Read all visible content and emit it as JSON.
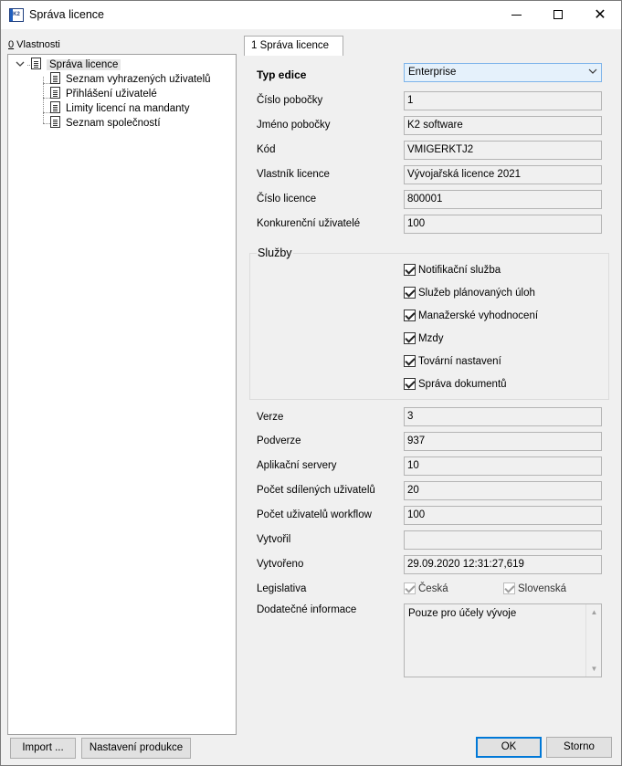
{
  "window": {
    "title": "Správa licence",
    "app_icon": "K2"
  },
  "left_panel": {
    "label_prefix": "0",
    "label": " Vlastnosti",
    "tree": {
      "root": "Správa licence",
      "children": [
        "Seznam vyhrazených uživatelů",
        "Přihlášení uživatelé",
        "Limity licencí na mandanty",
        "Seznam společností"
      ]
    }
  },
  "tab": {
    "label": "1 Správa licence"
  },
  "form": {
    "edition": {
      "label": "Typ edice",
      "value": "Enterprise"
    },
    "fields": [
      {
        "label": "Číslo pobočky",
        "value": "1"
      },
      {
        "label": "Jméno pobočky",
        "value": "K2 software"
      },
      {
        "label": "Kód",
        "value": "VMIGERKTJ2"
      },
      {
        "label": "Vlastník licence",
        "value": "Vývojařská licence 2021"
      },
      {
        "label": "Číslo licence",
        "value": "800001"
      },
      {
        "label": "Konkurenční uživatelé",
        "value": "100"
      }
    ],
    "services": {
      "title": "Služby",
      "items": [
        {
          "label": "Notifikační služba",
          "checked": true
        },
        {
          "label": "Služeb plánovaných úloh",
          "checked": true
        },
        {
          "label": "Manažerské vyhodnocení",
          "checked": true
        },
        {
          "label": "Mzdy",
          "checked": true
        },
        {
          "label": "Tovární nastavení",
          "checked": true
        },
        {
          "label": "Správa dokumentů",
          "checked": true
        }
      ]
    },
    "fields2": [
      {
        "label": "Verze",
        "value": "3"
      },
      {
        "label": "Podverze",
        "value": "937"
      },
      {
        "label": "Aplikační servery",
        "value": "10"
      },
      {
        "label": "Počet sdílených uživatelů",
        "value": "20"
      },
      {
        "label": "Počet uživatelů workflow",
        "value": "100"
      },
      {
        "label": "Vytvořil",
        "value": ""
      },
      {
        "label": "Vytvořeno",
        "value": "29.09.2020 12:31:27,619"
      }
    ],
    "legislation": {
      "label": "Legislativa",
      "options": [
        {
          "label": "Česká",
          "checked": true
        },
        {
          "label": "Slovenská",
          "checked": true
        }
      ]
    },
    "additional": {
      "label": "Dodatečné informace",
      "value": "Pouze pro účely vývoje"
    }
  },
  "buttons": {
    "import": "Import ...",
    "production": "Nastavení produkce",
    "ok": "OK",
    "cancel": "Storno"
  }
}
